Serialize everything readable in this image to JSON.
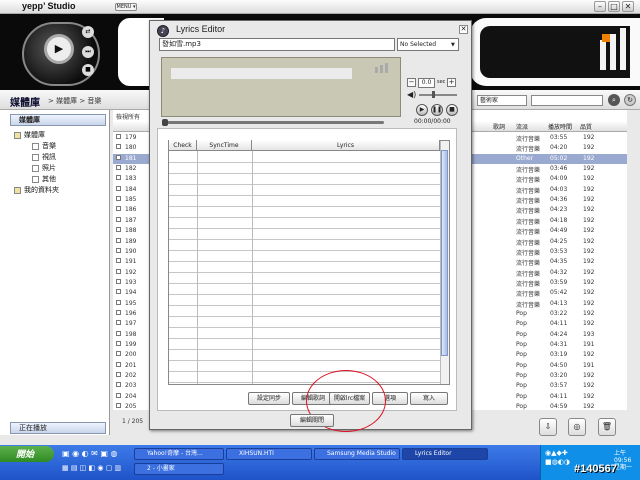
{
  "app": {
    "logo": "yepp’ Studio",
    "menu": "MENU ▾",
    "min": "–",
    "max": "□",
    "close": "✕"
  },
  "nav": {
    "library_title": "媒體庫",
    "breadcrumb": "> 媒體庫 > 音樂",
    "artist_filter": "藝術家"
  },
  "sidebar": {
    "head": "媒體庫",
    "items": [
      {
        "label": "媒體庫"
      },
      {
        "label": "音樂"
      },
      {
        "label": "視訊"
      },
      {
        "label": "照片"
      },
      {
        "label": "其他"
      },
      {
        "label": "我的資料夾"
      }
    ],
    "now_playing": "正在播放"
  },
  "table": {
    "all_label": "檢視所有",
    "headers": [
      "歌詞",
      "流派",
      "播放時間",
      "品質"
    ],
    "rows": [
      {
        "n": "179",
        "genre": "流行音樂",
        "time": "03:55",
        "q": "192"
      },
      {
        "n": "180",
        "genre": "流行音樂",
        "time": "04:20",
        "q": "192"
      },
      {
        "n": "181",
        "genre": "Other",
        "time": "05:02",
        "q": "192",
        "sel": true
      },
      {
        "n": "182",
        "genre": "流行音樂",
        "time": "03:46",
        "q": "192"
      },
      {
        "n": "183",
        "genre": "流行音樂",
        "time": "04:09",
        "q": "192"
      },
      {
        "n": "184",
        "genre": "流行音樂",
        "time": "04:03",
        "q": "192"
      },
      {
        "n": "185",
        "genre": "流行音樂",
        "time": "04:36",
        "q": "192"
      },
      {
        "n": "186",
        "genre": "流行音樂",
        "time": "04:23",
        "q": "192"
      },
      {
        "n": "187",
        "genre": "流行音樂",
        "time": "04:18",
        "q": "192"
      },
      {
        "n": "188",
        "genre": "流行音樂",
        "time": "04:49",
        "q": "192"
      },
      {
        "n": "189",
        "genre": "流行音樂",
        "time": "04:25",
        "q": "192"
      },
      {
        "n": "190",
        "genre": "流行音樂",
        "time": "03:53",
        "q": "192"
      },
      {
        "n": "191",
        "genre": "流行音樂",
        "time": "04:35",
        "q": "192"
      },
      {
        "n": "192",
        "genre": "流行音樂",
        "time": "04:32",
        "q": "192"
      },
      {
        "n": "193",
        "genre": "流行音樂",
        "time": "03:59",
        "q": "192"
      },
      {
        "n": "194",
        "genre": "流行音樂",
        "time": "05:42",
        "q": "192"
      },
      {
        "n": "195",
        "genre": "流行音樂",
        "time": "04:13",
        "q": "192"
      },
      {
        "n": "196",
        "genre": "Pop",
        "time": "03:22",
        "q": "192"
      },
      {
        "n": "197",
        "genre": "Pop",
        "time": "04:11",
        "q": "192"
      },
      {
        "n": "198",
        "genre": "Pop",
        "time": "04:24",
        "q": "193"
      },
      {
        "n": "199",
        "genre": "Pop",
        "time": "04:31",
        "q": "191"
      },
      {
        "n": "200",
        "genre": "Pop",
        "time": "03:19",
        "q": "192"
      },
      {
        "n": "201",
        "genre": "Pop",
        "time": "04:50",
        "q": "191"
      },
      {
        "n": "202",
        "genre": "Pop",
        "time": "03:20",
        "q": "192"
      },
      {
        "n": "203",
        "genre": "Pop",
        "time": "03:57",
        "q": "192"
      },
      {
        "n": "204",
        "genre": "Pop",
        "time": "04:11",
        "q": "192"
      },
      {
        "n": "205",
        "genre": "Pop",
        "time": "04:59",
        "q": "192"
      }
    ],
    "count": "1 / 205"
  },
  "dialog": {
    "title": "Lyrics Editor",
    "close": "✕",
    "file": "發如雪.mp3",
    "sync_select": "No Selected",
    "offset": "0.0",
    "offset_unit": "sec",
    "time": "00:00/00:00",
    "grid_headers": [
      "Check",
      "SyncTime",
      "Lyrics"
    ],
    "buttons": [
      "設定同步",
      "編輯歌詞",
      "開啟lrc檔案",
      "選項",
      "寫入"
    ],
    "close_button": "編輯關閉"
  },
  "taskbar": {
    "start": "開始",
    "tasks": [
      "Yahoo!奇摩 - 台灣...",
      "XIHSUN.HTI",
      "Samsung Media Studio",
      "Lyrics Editor"
    ],
    "tasks2": [
      "2 - 小畫家"
    ],
    "clock_time": "上午 09:56",
    "clock_day": "星期一",
    "watermark": "#140567"
  }
}
